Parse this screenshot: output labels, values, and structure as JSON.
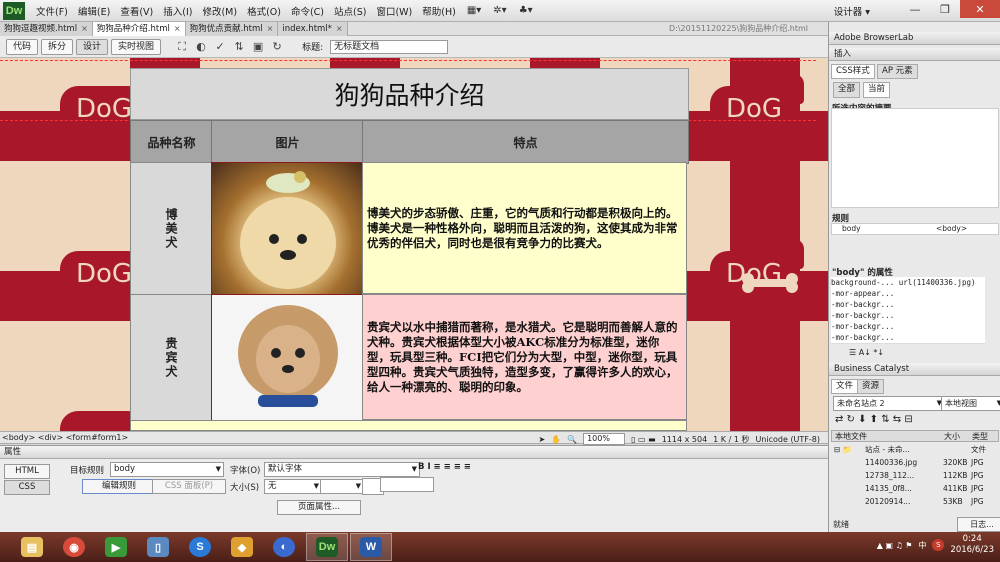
{
  "app": {
    "logo": "Dw",
    "designer": "设计器 ▾"
  },
  "menu": [
    "文件(F)",
    "编辑(E)",
    "查看(V)",
    "插入(I)",
    "修改(M)",
    "格式(O)",
    "命令(C)",
    "站点(S)",
    "窗口(W)",
    "帮助(H)"
  ],
  "doc_tabs": [
    {
      "label": "狗狗逗趣视频.html",
      "active": false
    },
    {
      "label": "狗狗品种介绍.html",
      "active": true
    },
    {
      "label": "狗狗优点贡献.html",
      "active": false
    },
    {
      "label": "index.html*",
      "active": false
    }
  ],
  "file_path": "D:\\20151120225\\狗狗品种介绍.html",
  "toolbar": {
    "code": "代码",
    "split": "拆分",
    "design": "设计",
    "live": "实时视图",
    "title_label": "标题:",
    "title_value": "无标题文档"
  },
  "page": {
    "title": "狗狗品种介绍",
    "headers": [
      "品种名称",
      "图片",
      "特点"
    ],
    "rows": [
      {
        "name": "博美犬",
        "desc": "博美犬的步态骄傲、庄重，它的气质和行动都是积极向上的。博美犬是一种性格外向，聪明而且活泼的狗，这使其成为非常优秀的伴侣犬，同时也是很有竞争力的比赛犬。"
      },
      {
        "name": "贵宾犬",
        "desc": "贵宾犬以水中捕猎而著称，是水猎犬。它是聪明而善解人意的犬种。贵宾犬根据体型大小被AKC标准分为标准型，迷你型，玩具型三种。FCI把它们分为大型，中型，迷你型，玩具型四种。贵宾犬气质独特，造型多变，了赢得许多人的欢心，给人一种漂亮的、聪明的印象。"
      }
    ],
    "bg_text": "DoG"
  },
  "status": {
    "tags": "<body> <div> <form#form1>",
    "zoom": "100%",
    "size": "1114 x 504",
    "weight": "1 K / 1 秒",
    "encoding": "Unicode (UTF-8)"
  },
  "props": {
    "title": "属性",
    "html": "HTML",
    "css": "CSS",
    "target_rule_label": "目标规则",
    "target_rule_value": "body",
    "edit_rule": "编辑规则",
    "css_panel": "CSS 面板(P)",
    "font_label": "字体(O)",
    "font_value": "默认字体",
    "size_label": "大小(S)",
    "size_value": "无",
    "page_props": "页面属性..."
  },
  "rpanel": {
    "browserlab": "Adobe BrowserLab",
    "insert": "插入",
    "css_tab": "CSS样式",
    "ap_tab": "AP 元素",
    "all": "全部",
    "current": "当前",
    "summary": "所选内容的摘要",
    "rules_label": "规则",
    "rule_name": "body",
    "rule_tag": "<body>",
    "props_label": "\"body\" 的属性",
    "props_rows": [
      {
        "k": "background-...",
        "v": "url(11400336.jpg)"
      },
      {
        "k": "-mor-appear...",
        "v": ""
      },
      {
        "k": "-mor-backgr...",
        "v": ""
      },
      {
        "k": "-mor-backgr...",
        "v": ""
      },
      {
        "k": "-mor-backgr...",
        "v": ""
      },
      {
        "k": "-mor-backgr...",
        "v": ""
      },
      {
        "k": "-mor-backgr...",
        "v": ""
      }
    ],
    "catalyst": "Business Catalyst",
    "files_tab": "文件",
    "assets_tab": "资源",
    "site_select": "未命名站点 2",
    "view_select": "本地视图",
    "local_files": "本地文件",
    "size_col": "大小",
    "type_col": "类型",
    "site_row": "站点 - 未命...",
    "site_type": "文件",
    "files": [
      {
        "name": "11400336.jpg",
        "size": "320KB",
        "type": "JPG"
      },
      {
        "name": "12738_112...",
        "size": "112KB",
        "type": "JPG"
      },
      {
        "name": "14135_0f8...",
        "size": "411KB",
        "type": "JPG"
      },
      {
        "name": "20120914...",
        "size": "53KB",
        "type": "JPG"
      }
    ],
    "ready": "就绪",
    "log": "日志..."
  },
  "taskbar": {
    "time": "0:24",
    "date": "2016/6/23",
    "ime": "中",
    "apps": [
      "Dw",
      "W"
    ]
  },
  "colors": {
    "accent": "#a8172a",
    "bg_tan": "#efd7bd",
    "row1": "#ffffcc",
    "row2": "#ffd0d0"
  }
}
